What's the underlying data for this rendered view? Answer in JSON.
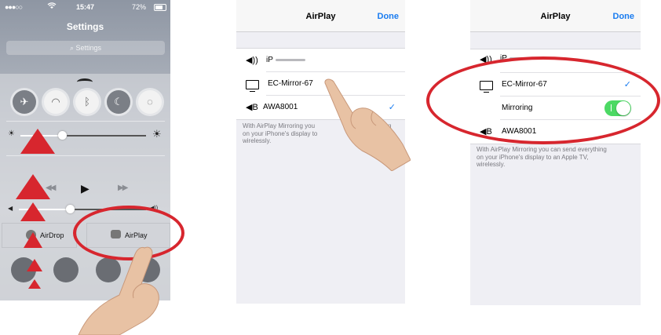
{
  "panel1": {
    "status": {
      "signal": "●●●○○",
      "wifi_icon": "wifi-icon",
      "time": "15:47",
      "battery": "72%"
    },
    "settings_title": "Settings",
    "search_placeholder": "Settings",
    "toggles": [
      {
        "name": "airplane-mode",
        "icon": "✈",
        "on": false
      },
      {
        "name": "wifi",
        "icon": "◠",
        "on": true
      },
      {
        "name": "bluetooth",
        "icon": "ᛒ",
        "on": true
      },
      {
        "name": "do-not-disturb",
        "icon": "☾",
        "on": false
      },
      {
        "name": "rotation-lock",
        "icon": "◌",
        "on": true
      }
    ],
    "brightness": {
      "value": 0.33,
      "low_icon": "☀",
      "high_icon": "☀"
    },
    "media": {
      "prev": "◀◀",
      "play": "▶",
      "next": "▶▶"
    },
    "volume": {
      "value": 0.4,
      "low_icon": "◀",
      "high_icon": "◀))"
    },
    "airdrop_label": "AirDrop",
    "airplay_label": "AirPlay"
  },
  "panel2": {
    "title": "AirPlay",
    "done": "Done",
    "rows": [
      {
        "icon": "◀))",
        "label": "iP",
        "checked": false
      },
      {
        "icon": "tv",
        "label": "EC-Mirror-67",
        "checked": false
      },
      {
        "icon": "◀B",
        "label": "AWA8001",
        "checked": true
      }
    ],
    "footer": [
      "With AirPlay Mirroring you",
      "thing",
      "on your iPhone's display to",
      "wirelessly."
    ]
  },
  "panel3": {
    "title": "AirPlay",
    "done": "Done",
    "rows": [
      {
        "icon": "◀))",
        "label": "iP",
        "checked": false
      },
      {
        "icon": "tv",
        "label": "EC-Mirror-67",
        "checked": true
      },
      {
        "label": "Mirroring",
        "toggle": true
      },
      {
        "icon": "◀B",
        "label": "AWA8001",
        "checked": false
      }
    ],
    "footer": [
      "With AirPlay Mirroring you can send everything",
      "on your iPhone's display to an Apple TV,",
      "wirelessly."
    ]
  },
  "checkmark": "✓",
  "colors": {
    "accent": "#1a7cf0",
    "highlight_red": "#d7262e",
    "switch_on": "#4cd964"
  }
}
